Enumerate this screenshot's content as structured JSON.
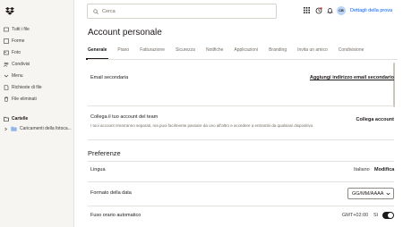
{
  "app": {
    "logo_icon": "dropbox-logo-icon"
  },
  "sidebar": {
    "items": [
      {
        "label": "Tutti i file",
        "icon": "files-icon"
      },
      {
        "label": "Forme",
        "icon": "shapes-icon"
      },
      {
        "label": "Foto",
        "icon": "photo-icon"
      },
      {
        "label": "Condivisi",
        "icon": "shared-icon"
      },
      {
        "label": "Menu",
        "icon": "chevron-icon"
      },
      {
        "label": "Richieste di file",
        "icon": "file-request-icon"
      },
      {
        "label": "File eliminati",
        "icon": "trash-icon"
      }
    ],
    "folder_header": "Cartelle",
    "folder_item": "Caricamenti della fotoca..."
  },
  "header": {
    "search_placeholder": "Cerca",
    "avatar_initials": "CB",
    "trial_link": "Dettagli della prova"
  },
  "page": {
    "title": "Account personale",
    "tabs": [
      {
        "label": "Generale",
        "active": true
      },
      {
        "label": "Piano"
      },
      {
        "label": "Fatturazione"
      },
      {
        "label": "Sicurezza"
      },
      {
        "label": "Notifiche"
      },
      {
        "label": "Applicazioni"
      },
      {
        "label": "Branding"
      },
      {
        "label": "Invita un amico"
      },
      {
        "label": "Condivisione"
      }
    ]
  },
  "settings": {
    "secondary_email": {
      "label": "Email secondaria",
      "action": "Aggiungi indirizzo email secondario"
    },
    "link_team": {
      "label": "Collega il tuo account del team",
      "description": "I tuoi account rimarranno separati, ma puoi facilmente passare da uno all'altro e accedere a entrambi da qualsiasi dispositivo.",
      "action": "Collega account"
    },
    "preferences_title": "Preferenze",
    "language": {
      "label": "Lingua",
      "value": "Italiano",
      "action": "Modifica"
    },
    "date_format": {
      "label": "Formato della data",
      "value": "GG/MM/AAAA"
    },
    "timezone": {
      "label": "Fuso orario automatico",
      "value": "GMT+02:00",
      "switch_label": "Sì",
      "enabled": true
    }
  }
}
